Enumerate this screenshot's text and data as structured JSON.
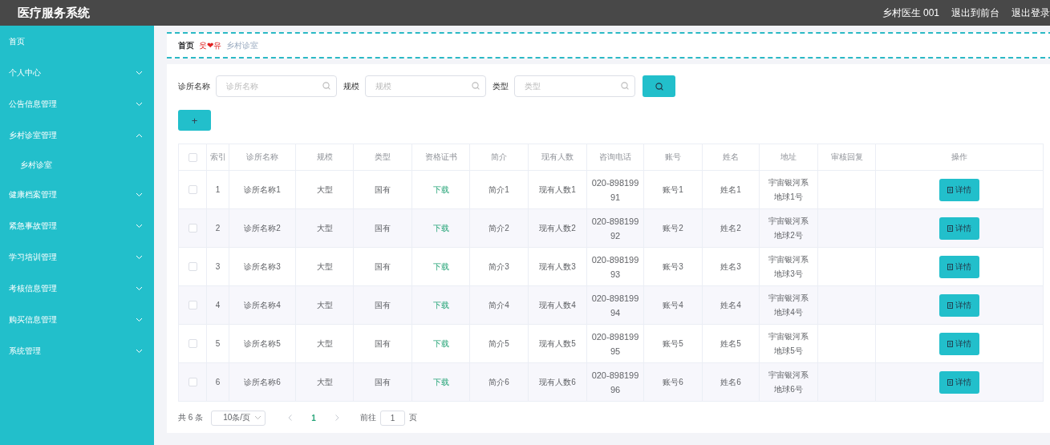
{
  "header": {
    "title": "医疗服务系统",
    "user": "乡村医生 001",
    "links": [
      "退出到前台",
      "退出登录"
    ]
  },
  "sidebar": {
    "items": [
      {
        "label": "首页",
        "kind": "link"
      },
      {
        "label": "个人中心",
        "kind": "submenu",
        "expanded": false
      },
      {
        "label": "公告信息管理",
        "kind": "submenu",
        "expanded": false
      },
      {
        "label": "乡村诊室管理",
        "kind": "submenu",
        "expanded": true,
        "children": [
          {
            "label": "乡村诊室"
          }
        ]
      },
      {
        "label": "健康档案管理",
        "kind": "submenu",
        "expanded": false
      },
      {
        "label": "紧急事故管理",
        "kind": "submenu",
        "expanded": false
      },
      {
        "label": "学习培训管理",
        "kind": "submenu",
        "expanded": false
      },
      {
        "label": "考核信息管理",
        "kind": "submenu",
        "expanded": false
      },
      {
        "label": "购买信息管理",
        "kind": "submenu",
        "expanded": false
      },
      {
        "label": "系统管理",
        "kind": "submenu",
        "expanded": false
      }
    ]
  },
  "breadcrumb": {
    "home": "首页",
    "separator": "웃❤유",
    "current": "乡村诊室"
  },
  "search": {
    "fields": [
      {
        "label": "诊所名称",
        "placeholder": "诊所名称"
      },
      {
        "label": "规模",
        "placeholder": "规模"
      },
      {
        "label": "类型",
        "placeholder": "类型"
      }
    ]
  },
  "add_button": "+",
  "table": {
    "all_checked": false,
    "columns": [
      "索引",
      "诊所名称",
      "规模",
      "类型",
      "资格证书",
      "简介",
      "现有人数",
      "咨询电话",
      "账号",
      "姓名",
      "地址",
      "审核回复",
      "操作"
    ],
    "rows": [
      {
        "checked": false,
        "index": "1",
        "name": "诊所名称1",
        "scale": "大型",
        "type": "国有",
        "certificate": "下载",
        "intro": "简介1",
        "count": "现有人数1",
        "phone": "020-89819991",
        "account": "账号1",
        "person": "姓名1",
        "address": "宇宙银河系地球1号",
        "action": "详情"
      },
      {
        "checked": false,
        "index": "2",
        "name": "诊所名称2",
        "scale": "大型",
        "type": "国有",
        "certificate": "下载",
        "intro": "简介2",
        "count": "现有人数2",
        "phone": "020-89819992",
        "account": "账号2",
        "person": "姓名2",
        "address": "宇宙银河系地球2号",
        "action": "详情"
      },
      {
        "checked": false,
        "index": "3",
        "name": "诊所名称3",
        "scale": "大型",
        "type": "国有",
        "certificate": "下载",
        "intro": "简介3",
        "count": "现有人数3",
        "phone": "020-89819993",
        "account": "账号3",
        "person": "姓名3",
        "address": "宇宙银河系地球3号",
        "action": "详情"
      },
      {
        "checked": false,
        "index": "4",
        "name": "诊所名称4",
        "scale": "大型",
        "type": "国有",
        "certificate": "下载",
        "intro": "简介4",
        "count": "现有人数4",
        "phone": "020-89819994",
        "account": "账号4",
        "person": "姓名4",
        "address": "宇宙银河系地球4号",
        "action": "详情"
      },
      {
        "checked": false,
        "index": "5",
        "name": "诊所名称5",
        "scale": "大型",
        "type": "国有",
        "certificate": "下载",
        "intro": "简介5",
        "count": "现有人数5",
        "phone": "020-89819995",
        "account": "账号5",
        "person": "姓名5",
        "address": "宇宙银河系地球5号",
        "action": "详情"
      },
      {
        "checked": false,
        "index": "6",
        "name": "诊所名称6",
        "scale": "大型",
        "type": "国有",
        "certificate": "下载",
        "intro": "简介6",
        "count": "现有人数6",
        "phone": "020-89819996",
        "account": "账号6",
        "person": "姓名6",
        "address": "宇宙银河系地球6号",
        "action": "详情"
      }
    ]
  },
  "pagination": {
    "total": "共 6 条",
    "page_size": "10条/页",
    "pages": [
      {
        "label": "1",
        "selected": true
      }
    ],
    "goto_label": "前往",
    "goto_value": "1",
    "goto_suffix": "页"
  }
}
